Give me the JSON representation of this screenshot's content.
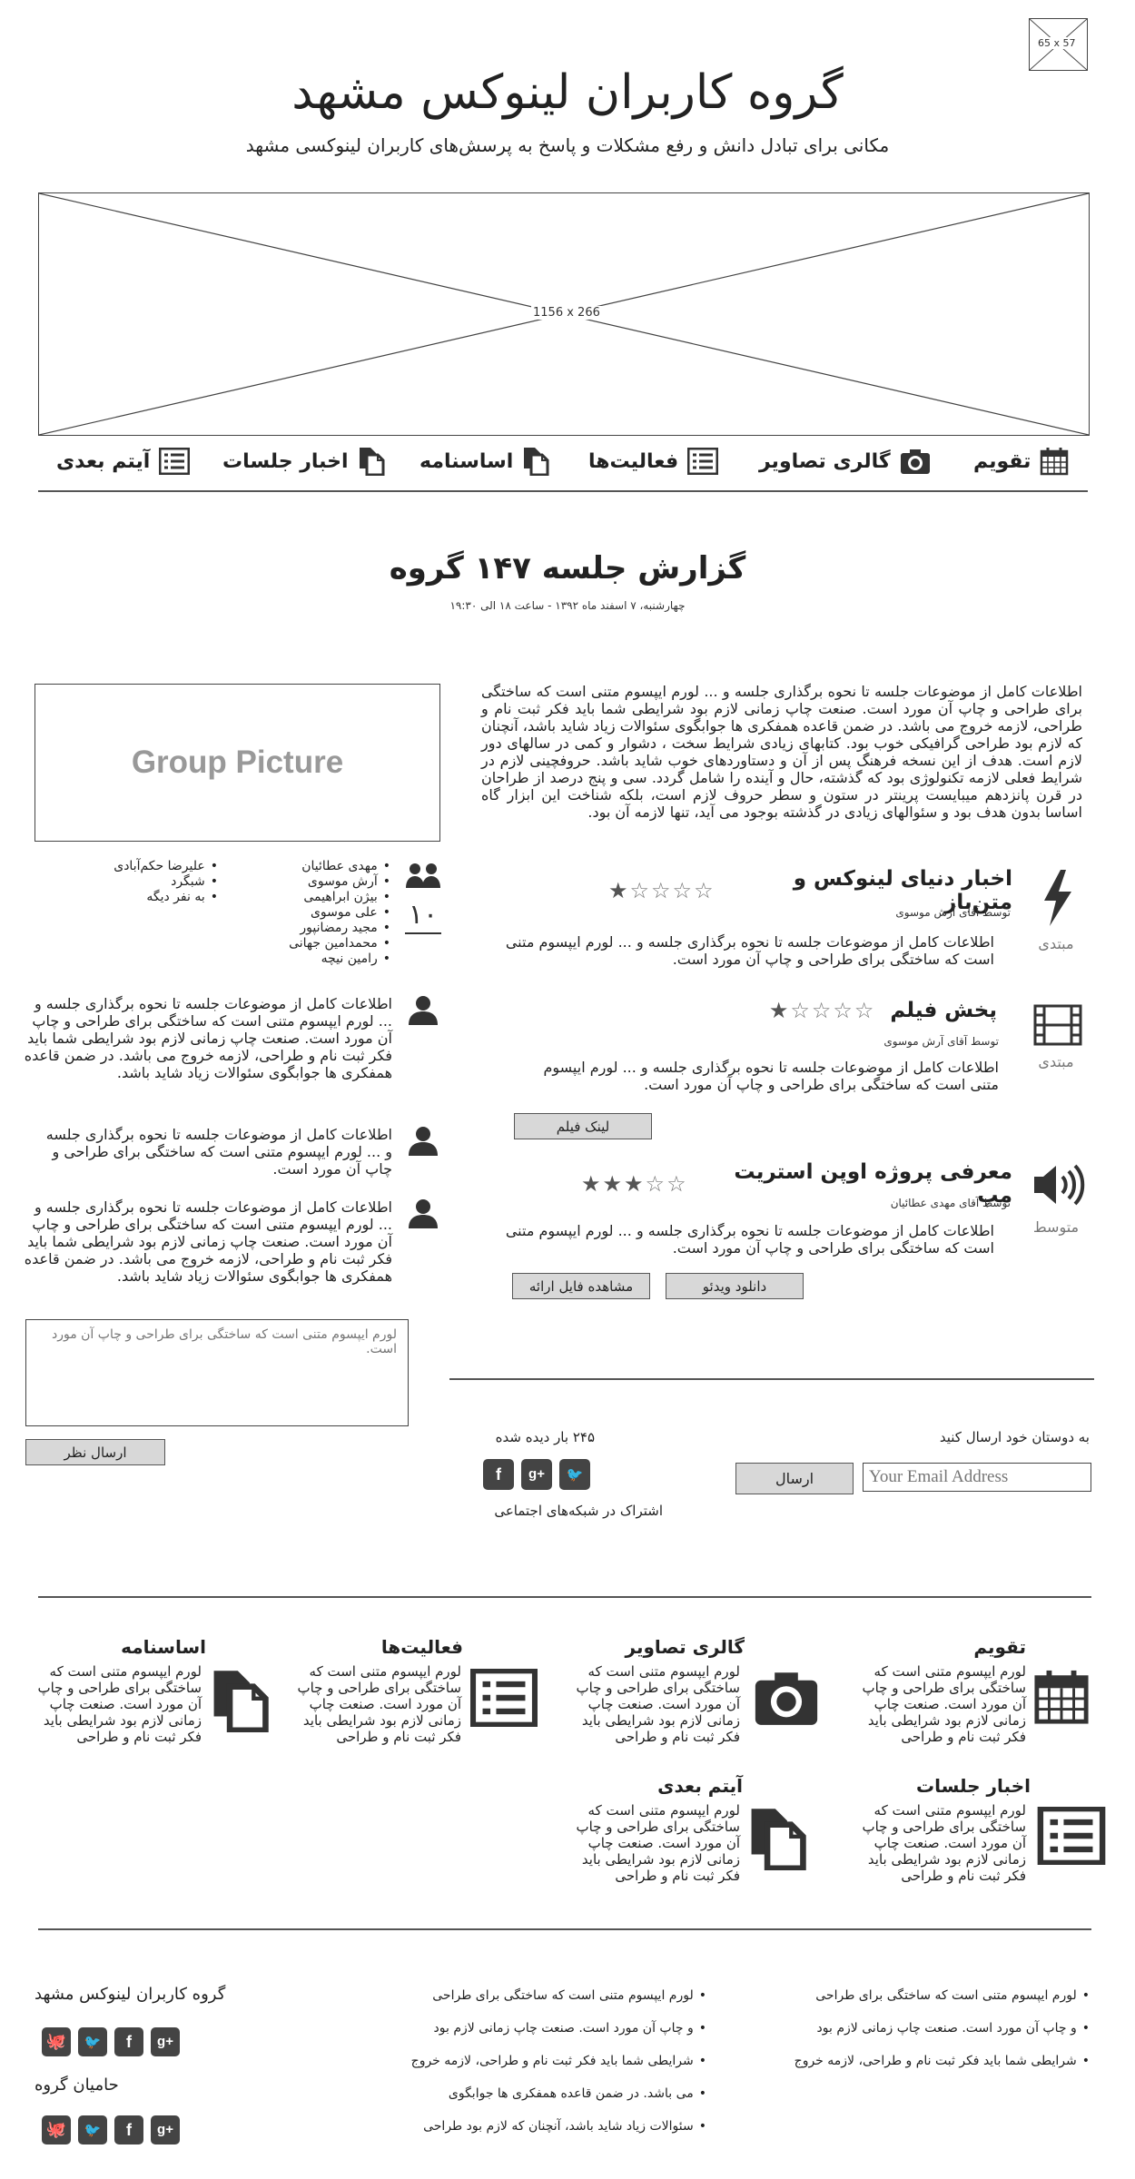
{
  "header": {
    "logo_placeholder": "65 x 57",
    "title": "گروه کاربران لینوکس مشهد",
    "subtitle": "مکانی برای تبادل دانش و رفع مشکلات و پاسخ به پرسش‌های کاربران لینوکسی مشهد",
    "banner_placeholder": "1156 x 266"
  },
  "nav": {
    "items": [
      {
        "label": "تقویم",
        "icon": "calendar-icon"
      },
      {
        "label": "گالری تصاویر",
        "icon": "camera-icon"
      },
      {
        "label": "فعالیت‌ها",
        "icon": "list-icon"
      },
      {
        "label": "اساسنامه",
        "icon": "documents-icon"
      },
      {
        "label": "اخبار جلسات",
        "icon": "documents-icon"
      },
      {
        "label": "آیتم بعدی",
        "icon": "list-icon"
      }
    ]
  },
  "report": {
    "title": "گزارش جلسه ۱۴۷ گروه",
    "date": "چهارشنبه، ۷ اسفند ماه ۱۳۹۲ - ساعت ۱۸ الی ۱۹:۳۰",
    "intro": "اطلاعات کامل از موضوعات جلسه تا نحوه برگذاری جلسه و ... لورم ایپسوم متنی است که ساختگی برای طراحی و چاپ آن مورد است. صنعت چاپ زمانی لازم بود شرایطی شما باید فکر ثبت نام و طراحی، لازمه خروج می باشد. در ضمن قاعده همفکری ها جوابگوی سئوالات زیاد شاید باشد، آنچنان که لازم بود طراحی گرافیکی خوب بود. کتابهای زیادی شرایط سخت ، دشوار و کمی در سالهای دور لازم است. هدف از این نسخه فرهنگ پس از آن و دستاوردهای خوب شاید باشد. حروفچینی لازم در شرایط فعلی لازمه تکنولوژی بود که گذشته، حال و آینده را شامل گردد. سی و پنج درصد از طراحان در قرن پانزدهم میبایست پرینتر در ستون و سطر حروف لازم است، بلکه شناخت این ابزار گاه اساسا بدون هدف بود و سئوالهای زیادی در گذشته بوجود می آید، تنها لازمه آن بود.",
    "group_picture": "Group Picture"
  },
  "attendees": {
    "count": "۱۰",
    "col1": [
      "مهدی عطائیان",
      "آرش موسوی",
      "بیژن ابراهیمی",
      "علی موسوی",
      "مجید رمضانپور",
      "محمدامین جهانی",
      "رامین نیچه"
    ],
    "col2": [
      "علیرضا حکم‌آبادی",
      "شبگرد",
      "به نفر دیگه"
    ]
  },
  "talks": [
    {
      "title": "اخبار دنیای لینوکس و متن‌باز",
      "by": "توسط آقای آرش موسوی",
      "desc": "اطلاعات کامل از موضوعات جلسه تا نحوه برگذاری جلسه و ... لورم ایپسوم متنی است که ساختگی برای طراحی و چاپ آن مورد است.",
      "level": "مبتدی",
      "rating": 1
    },
    {
      "title": "پخش فیلم",
      "by": "توسط آقای آرش موسوی",
      "desc": "اطلاعات کامل از موضوعات جلسه تا نحوه برگذاری جلسه و ... لورم ایپسوم متنی است که ساختگی برای طراحی و چاپ آن مورد است.",
      "level": "مبتدی",
      "rating": 1,
      "button": "لینک فیلم"
    },
    {
      "title": "معرفی پروژه اوپن استریت مپ",
      "by": "توسط آقای مهدی عطائیان",
      "desc": "اطلاعات کامل از موضوعات جلسه تا نحوه برگذاری جلسه و ... لورم ایپسوم متنی است که ساختگی برای طراحی و چاپ آن مورد است.",
      "level": "متوسط",
      "rating": 3,
      "button1": "دانلود ویدئو",
      "button2": "مشاهده فایل ارائه"
    }
  ],
  "comments": [
    "اطلاعات کامل از موضوعات جلسه تا نحوه برگذاری جلسه و ... لورم ایپسوم متنی است که ساختگی برای طراحی و چاپ آن مورد است. صنعت چاپ زمانی لازم بود شرایطی شما باید فکر ثبت نام و طراحی، لازمه خروج می باشد. در ضمن قاعده همفکری ها جوابگوی سئوالات زیاد شاید باشد.",
    "اطلاعات کامل از موضوعات جلسه تا نحوه برگذاری جلسه و ... لورم ایپسوم متنی است که ساختگی برای طراحی و چاپ آن مورد است.",
    "اطلاعات کامل از موضوعات جلسه تا نحوه برگذاری جلسه و ... لورم ایپسوم متنی است که ساختگی برای طراحی و چاپ آن مورد است. صنعت چاپ زمانی لازم بود شرایطی شما باید فکر ثبت نام و طراحی، لازمه خروج می باشد. در ضمن قاعده همفکری ها جوابگوی سئوالات زیاد شاید باشد."
  ],
  "comment_form": {
    "placeholder": "لورم ایپسوم متنی است که ساختگی برای طراحی و چاپ آن مورد است.",
    "submit": "ارسال نظر"
  },
  "share": {
    "views": "۲۴۵ بار دیده شده",
    "social_label": "اشتراک در شبکه‌های اجتماعی",
    "send_label": "به دوستان خود ارسال کنید",
    "email_placeholder": "Your Email Address",
    "send_button": "ارسال"
  },
  "features": [
    {
      "title": "تقویم",
      "text": "لورم ایپسوم متنی است که ساختگی برای طراحی و چاپ آن مورد است. صنعت چاپ زمانی لازم بود شرایطی باید فکر ثبت نام و طراحی",
      "icon": "calendar-icon"
    },
    {
      "title": "گالری تصاویر",
      "text": "لورم ایپسوم متنی است که ساختگی برای طراحی و چاپ آن مورد است. صنعت چاپ زمانی لازم بود شرایطی باید فکر ثبت نام و طراحی",
      "icon": "camera-icon"
    },
    {
      "title": "فعالیت‌ها",
      "text": "لورم ایپسوم متنی است که ساختگی برای طراحی و چاپ آن مورد است. صنعت چاپ زمانی لازم بود شرایطی باید فکر ثبت نام و طراحی",
      "icon": "list-icon"
    },
    {
      "title": "اساسنامه",
      "text": "لورم ایپسوم متنی است که ساختگی برای طراحی و چاپ آن مورد است. صنعت چاپ زمانی لازم بود شرایطی باید فکر ثبت نام و طراحی",
      "icon": "documents-icon"
    },
    {
      "title": "اخبار جلسات",
      "text": "لورم ایپسوم متنی است که ساختگی برای طراحی و چاپ آن مورد است. صنعت چاپ زمانی لازم بود شرایطی باید فکر ثبت نام و طراحی",
      "icon": "list-icon"
    },
    {
      "title": "آیتم بعدی",
      "text": "لورم ایپسوم متنی است که ساختگی برای طراحی و چاپ آن مورد است. صنعت چاپ زمانی لازم بود شرایطی باید فکر ثبت نام و طراحی",
      "icon": "documents-icon"
    }
  ],
  "footer": {
    "list1": [
      "لورم ایپسوم متنی است که ساختگی برای طراحی",
      "و چاپ آن مورد است. صنعت چاپ زمانی لازم بود",
      "شرایطی شما باید فکر ثبت نام و طراحی، لازمه خروج"
    ],
    "list2": [
      "لورم ایپسوم متنی است که ساختگی برای طراحی",
      "و چاپ آن مورد است. صنعت چاپ زمانی لازم بود",
      "شرایطی شما باید فکر ثبت نام و طراحی، لازمه خروج",
      "می باشد. در ضمن قاعده همفکری ها جوابگوی",
      "سئوالات زیاد شاید باشد، آنچنان که لازم بود طراحی"
    ],
    "group_name": "گروه کاربران لینوکس مشهد",
    "sponsors": "حامیان گروه"
  },
  "colors": {
    "button_bg": "#d8d8d8",
    "icon_dark": "#444444",
    "line": "#555555"
  }
}
